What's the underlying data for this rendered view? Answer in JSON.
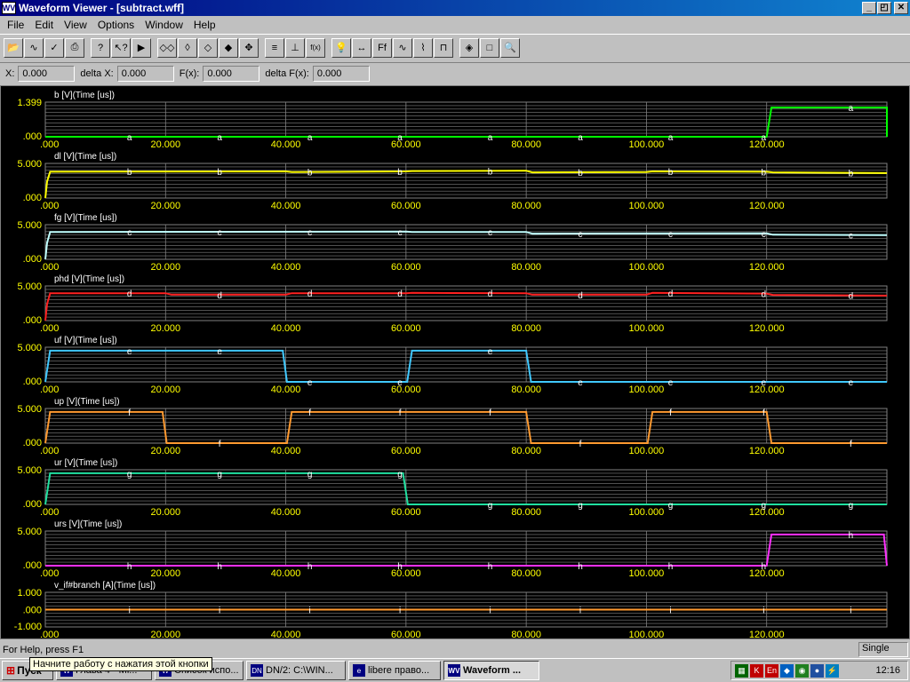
{
  "window": {
    "title": "Waveform Viewer - [subtract.wff]",
    "app_icon_label": "WV",
    "buttons": {
      "minimize": "_",
      "restore": "◰",
      "close": "✕"
    }
  },
  "menu": [
    "File",
    "Edit",
    "View",
    "Options",
    "Window",
    "Help"
  ],
  "toolbar": {
    "groups": [
      [
        "open-icon",
        "wave-icon",
        "check-icon",
        "print-icon"
      ],
      [
        "help-icon",
        "context-help-icon",
        "run-icon"
      ],
      [
        "zoom-x-icon",
        "zoom-y-icon",
        "zoom-x-in-icon",
        "zoom-y-in-icon",
        "pan-icon"
      ],
      [
        "list-icon",
        "cursor-icon",
        "function-icon"
      ],
      [
        "marker-icon",
        "measure-icon",
        "freq-icon",
        "wave-a-icon",
        "wave-b-icon",
        "wave-c-icon"
      ],
      [
        "tool-a-icon",
        "tool-b-icon",
        "magnify-icon"
      ]
    ],
    "glyphs": {
      "open-icon": "📂",
      "wave-icon": "∿",
      "check-icon": "✓",
      "print-icon": "⎙",
      "help-icon": "?",
      "context-help-icon": "↖?",
      "run-icon": "▶",
      "zoom-x-icon": "◇◇",
      "zoom-y-icon": "◊",
      "zoom-x-in-icon": "◇",
      "zoom-y-in-icon": "◆",
      "pan-icon": "✥",
      "list-icon": "≡",
      "cursor-icon": "⊥",
      "function-icon": "f(x)",
      "marker-icon": "💡",
      "measure-icon": "↔",
      "freq-icon": "Ff",
      "wave-a-icon": "∿",
      "wave-b-icon": "⌇",
      "wave-c-icon": "⊓",
      "tool-a-icon": "◈",
      "tool-b-icon": "□",
      "magnify-icon": "🔍"
    }
  },
  "coords": {
    "x_label": "X:",
    "x_value": "0.000",
    "dx_label": "delta X:",
    "dx_value": "0.000",
    "fx_label": "F(x):",
    "fx_value": "0.000",
    "dfx_label": "delta F(x):",
    "dfx_value": "0.000"
  },
  "colors": {
    "background": "#000000",
    "grid": "#808080",
    "axis_text": "#ffff00",
    "label_text": "#ffffff"
  },
  "x_ticks": [
    ".000",
    "20.000",
    "40.000",
    "60.000",
    "80.000",
    "100.000",
    "120.000"
  ],
  "x_tick_values": [
    0,
    20,
    40,
    60,
    80,
    100,
    120
  ],
  "x_max": 140,
  "chart_data": {
    "type": "line",
    "xlabel": "Time [us]",
    "x_range": [
      0,
      140
    ],
    "panels": [
      {
        "name": "b [V](Time [us])",
        "ymax": "1.399",
        "ymin": ".000",
        "ylim": [
          0,
          1.399
        ],
        "color": "#00ff00",
        "marker": "a",
        "x": [
          0,
          120,
          120.8,
          140,
          140
        ],
        "y": [
          0,
          0,
          1.18,
          1.18,
          0
        ],
        "markers_x": [
          14,
          29,
          44,
          59,
          74,
          89,
          104,
          119.5,
          134
        ]
      },
      {
        "name": "dl [V](Time [us])",
        "ymax": "5.000",
        "ymin": ".000",
        "ylim": [
          0,
          5
        ],
        "color": "#ffff00",
        "marker": "b",
        "x": [
          0,
          0.3,
          0.8,
          40,
          41,
          60,
          61,
          80,
          81,
          100,
          101,
          120,
          121,
          140
        ],
        "y": [
          0,
          2.4,
          3.8,
          3.85,
          3.75,
          3.85,
          3.9,
          3.95,
          3.7,
          3.75,
          3.85,
          3.8,
          3.7,
          3.6
        ],
        "markers_x": [
          14,
          29,
          44,
          59,
          74,
          89,
          104,
          119.5,
          134
        ]
      },
      {
        "name": "fg [V](Time [us])",
        "ymax": "5.000",
        "ymin": ".000",
        "ylim": [
          0,
          5
        ],
        "color": "#c0ffff",
        "marker": "c",
        "x": [
          0,
          0.3,
          0.8,
          60,
          61,
          80,
          81,
          120,
          121,
          140
        ],
        "y": [
          0,
          2.4,
          3.95,
          4.0,
          3.95,
          3.95,
          3.7,
          3.75,
          3.55,
          3.5
        ],
        "markers_x": [
          14,
          29,
          44,
          59,
          74,
          89,
          104,
          119.5,
          134
        ]
      },
      {
        "name": "phd [V](Time [us])",
        "ymax": "5.000",
        "ymin": ".000",
        "ylim": [
          0,
          5
        ],
        "color": "#ff2020",
        "marker": "d",
        "x": [
          0,
          0.3,
          0.8,
          20,
          21,
          40,
          41,
          60,
          61,
          80,
          81,
          100,
          101,
          120,
          121,
          140
        ],
        "y": [
          0,
          2.4,
          3.95,
          3.95,
          3.75,
          3.75,
          3.95,
          3.95,
          4.0,
          3.95,
          3.75,
          3.75,
          4.0,
          3.9,
          3.7,
          3.6
        ],
        "markers_x": [
          14,
          29,
          44,
          59,
          74,
          89,
          104,
          119.5,
          134
        ]
      },
      {
        "name": "uf [V](Time [us])",
        "ymax": "5.000",
        "ymin": ".000",
        "ylim": [
          0,
          5
        ],
        "color": "#40c8ff",
        "marker": "e",
        "x": [
          0,
          0.8,
          39.5,
          40.2,
          60.2,
          61,
          80,
          80.8,
          140
        ],
        "y": [
          0,
          4.5,
          4.5,
          0,
          0,
          4.5,
          4.5,
          0,
          0
        ],
        "markers_x": [
          14,
          29,
          44,
          59,
          74,
          89,
          104,
          119.5,
          134
        ]
      },
      {
        "name": "up [V](Time [us])",
        "ymax": "5.000",
        "ymin": ".000",
        "ylim": [
          0,
          5
        ],
        "color": "#ff9a30",
        "marker": "f",
        "x": [
          0,
          0.8,
          19.5,
          20.2,
          40.2,
          41,
          80,
          80.8,
          100.2,
          101,
          120,
          120.8,
          140
        ],
        "y": [
          0,
          4.5,
          4.5,
          0,
          0,
          4.5,
          4.5,
          0,
          0,
          4.5,
          4.5,
          0,
          0
        ],
        "markers_x": [
          14,
          29,
          44,
          59,
          74,
          89,
          104,
          119.5,
          134
        ]
      },
      {
        "name": "ur [V](Time [us])",
        "ymax": "5.000",
        "ymin": ".000",
        "ylim": [
          0,
          5
        ],
        "color": "#20e0a0",
        "marker": "g",
        "x": [
          0,
          0.8,
          59.5,
          60.3,
          140
        ],
        "y": [
          0,
          4.5,
          4.5,
          0,
          0
        ],
        "markers_x": [
          14,
          29,
          44,
          59,
          74,
          89,
          104,
          119.5,
          134
        ]
      },
      {
        "name": "urs [V](Time [us])",
        "ymax": "5.000",
        "ymin": ".000",
        "ylim": [
          0,
          5
        ],
        "color": "#ff30ff",
        "marker": "h",
        "x": [
          0,
          120,
          120.8,
          139.5,
          140
        ],
        "y": [
          0,
          0,
          4.5,
          4.5,
          0
        ],
        "markers_x": [
          14,
          29,
          44,
          59,
          74,
          89,
          104,
          119.5,
          134
        ]
      },
      {
        "name": "v_if#branch [A](Time [us])",
        "ymax": "1.000",
        "ymid": ".000",
        "ymin": "-1.000",
        "ylim": [
          -1,
          1
        ],
        "color": "#ff9a30",
        "marker": "i",
        "x": [
          0,
          140
        ],
        "y": [
          0,
          0
        ],
        "markers_x": [
          14,
          29,
          44,
          59,
          74,
          89,
          104,
          119.5,
          134
        ]
      }
    ]
  },
  "status": {
    "message": "For Help, press F1",
    "mode": "Single"
  },
  "tooltip": "Начните работу с нажатия этой кнопки",
  "taskbar": {
    "start_label": "Пуск",
    "tasks": [
      {
        "label": "Глава 4 - Mi...",
        "icon": "W",
        "active": false
      },
      {
        "label": "Список испо...",
        "icon": "W",
        "active": false
      },
      {
        "label": "DN/2: C:\\WIN...",
        "icon": "DN",
        "active": false
      },
      {
        "label": "libere право...",
        "icon": "e",
        "active": false
      },
      {
        "label": "Waveform ...",
        "icon": "WV",
        "active": true
      }
    ],
    "tray_icons": [
      "network-icon",
      "k-icon",
      "en-lang-icon",
      "security-icon",
      "antivirus-icon",
      "drive-icon",
      "display-icon"
    ],
    "tray_glyphs": [
      "▦",
      "K",
      "En",
      "◆",
      "◉",
      "●",
      "⚡"
    ],
    "clock": "12:16"
  }
}
